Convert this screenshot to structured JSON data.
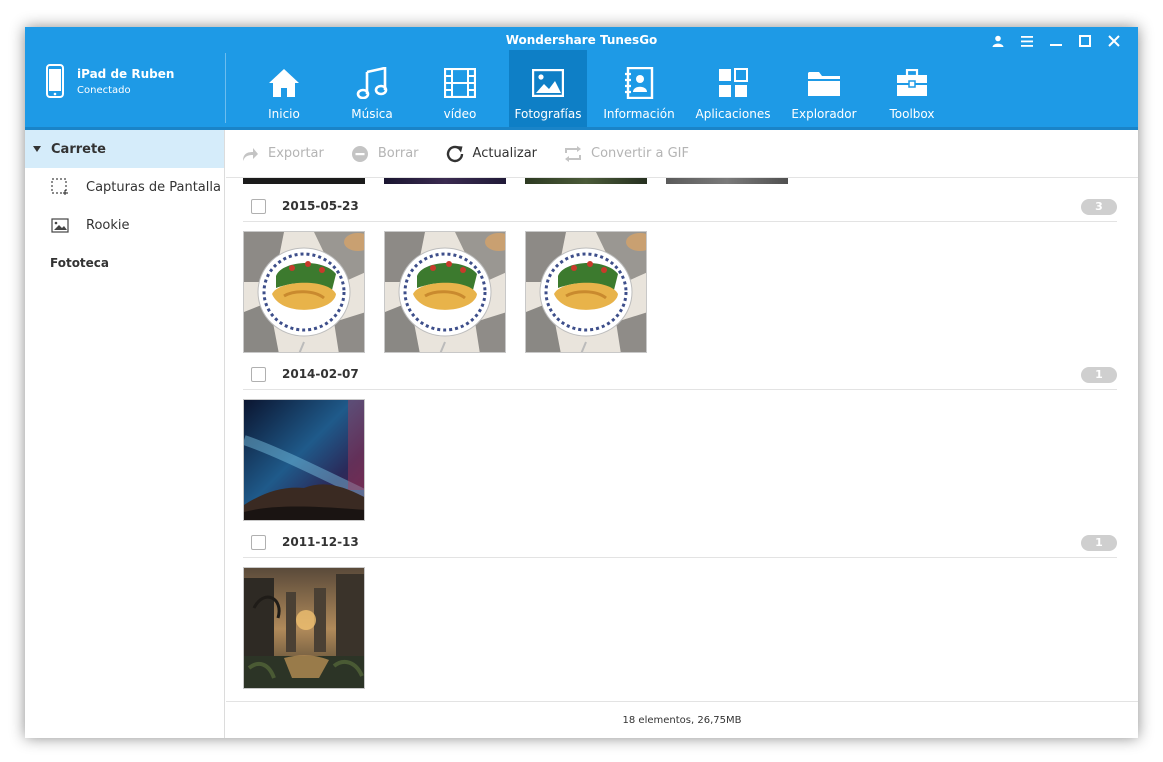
{
  "app": {
    "title": "Wondershare TunesGo"
  },
  "device": {
    "name": "iPad de Ruben",
    "status": "Conectado"
  },
  "nav": [
    {
      "label": "Inicio",
      "icon": "home-icon"
    },
    {
      "label": "Música",
      "icon": "music-icon"
    },
    {
      "label": "vídeo",
      "icon": "film-icon"
    },
    {
      "label": "Fotografías",
      "icon": "photo-icon",
      "active": true
    },
    {
      "label": "Información",
      "icon": "contacts-icon"
    },
    {
      "label": "Aplicaciones",
      "icon": "apps-icon"
    },
    {
      "label": "Explorador",
      "icon": "folder-icon"
    },
    {
      "label": "Toolbox",
      "icon": "toolbox-icon"
    }
  ],
  "sidebar": {
    "active": "Carrete",
    "items": [
      {
        "label": "Capturas de Pantalla",
        "icon": "screenshot-icon"
      },
      {
        "label": "Rookie",
        "icon": "image-icon"
      }
    ],
    "group": "Fototeca"
  },
  "toolbar": {
    "export": "Exportar",
    "delete": "Borrar",
    "refresh": "Actualizar",
    "gif": "Convertir a GIF"
  },
  "groups": [
    {
      "date": "2015-05-23",
      "count": "3"
    },
    {
      "date": "2014-02-07",
      "count": "1"
    },
    {
      "date": "2011-12-13",
      "count": "1"
    }
  ],
  "footer": {
    "summary": "18 elementos, 26,75MB"
  },
  "colors": {
    "accent": "#1e9ae6",
    "active_nav": "#0e7fc6",
    "sidebar_active": "#d5ecfa"
  }
}
